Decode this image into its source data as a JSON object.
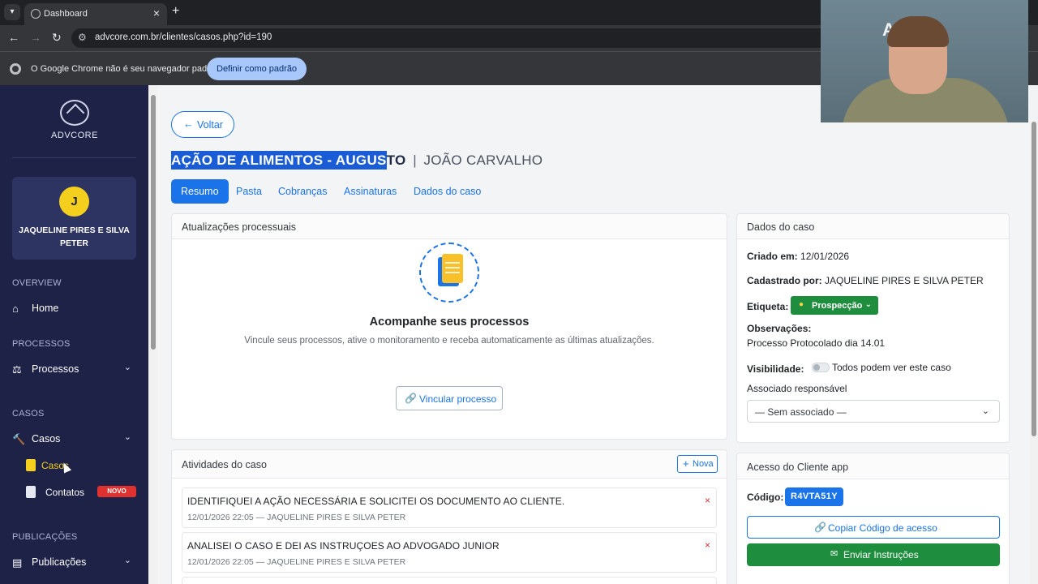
{
  "browser": {
    "tab_title": "Dashboard",
    "tab_close": "×",
    "new_tab": "+",
    "url": "advcore.com.br/clientes/casos.php?id=190",
    "infobar_message": "O Google Chrome não é seu navegador padrão",
    "infobar_button": "Definir como padrão"
  },
  "sidebar": {
    "logo_text": "ADVCORE",
    "user": {
      "initial": "J",
      "name": "JAQUELINE PIRES E SILVA PETER"
    },
    "sections": {
      "overview": "OVERVIEW",
      "processos": "PROCESSOS",
      "casos": "CASOS",
      "publicacoes": "PUBLICAÇÕES"
    },
    "items": {
      "home": "Home",
      "processos": "Processos",
      "casos": "Casos",
      "casos_sub": "Casos",
      "contatos": "Contatos",
      "contatos_badge": "NOVO",
      "publicacoes": "Publicações"
    }
  },
  "page": {
    "back_label": "Voltar",
    "case_title_highlight": "AÇÃO DE ALIMENTOS - AUGUS",
    "case_title_rest": "TO",
    "separator": "|",
    "client_name": "JOÃO CARVALHO",
    "tabs": [
      "Resumo",
      "Pasta",
      "Cobranças",
      "Assinaturas",
      "Dados do caso"
    ],
    "active_tab": "Resumo"
  },
  "updates_card": {
    "title": "Atualizações processuais",
    "empty_title": "Acompanhe seus processos",
    "empty_text": "Vincule seus processos, ative o monitoramento e receba automaticamente as últimas atualizações.",
    "link_button": "Vincular processo"
  },
  "activities_card": {
    "title": "Atividades do caso",
    "new_button": "Nova",
    "items": [
      {
        "text": "IDENTIFIQUEI A AÇÃO NECESSÁRIA E SOLICITEI OS DOCUMENTO AO CLIENTE.",
        "meta": "12/01/2026 22:05 — JAQUELINE PIRES E SILVA PETER",
        "delete": "×"
      },
      {
        "text": "ANALISEI O CASO E DEI AS INSTRUÇOES AO ADVOGADO JUNIOR",
        "meta": "12/01/2026 22:05 — JAQUELINE PIRES E SILVA PETER",
        "delete": "×"
      }
    ]
  },
  "case_data_card": {
    "title": "Dados do caso",
    "created_label": "Criado em:",
    "created_value": "12/01/2026",
    "registered_label": "Cadastrado por:",
    "registered_value": "JAQUELINE PIRES E SILVA PETER",
    "tag_label": "Etiqueta:",
    "tag_value": "Prospecção",
    "tag_color": "#1e8e3e",
    "notes_label": "Observações:",
    "notes_value": "Processo Protocolado dia 14.01",
    "visibility_label": "Visibilidade:",
    "visibility_value": "Todos podem ver este caso",
    "visibility_on": false,
    "associate_label": "Associado responsável",
    "associate_value": "— Sem associado —"
  },
  "client_access_card": {
    "title": "Acesso do Cliente app",
    "code_label": "Código:",
    "code_value": "R4VTA51Y",
    "copy_button": "Copiar Código de acesso",
    "send_button": "Enviar Instruções"
  },
  "webcam": {
    "wall_logo": "ADVC"
  },
  "colors": {
    "primary": "#1a73e8",
    "success": "#1e8e3e",
    "sidebar_bg": "#1e2247",
    "danger": "#e03131",
    "avatar": "#f5cf1d"
  }
}
